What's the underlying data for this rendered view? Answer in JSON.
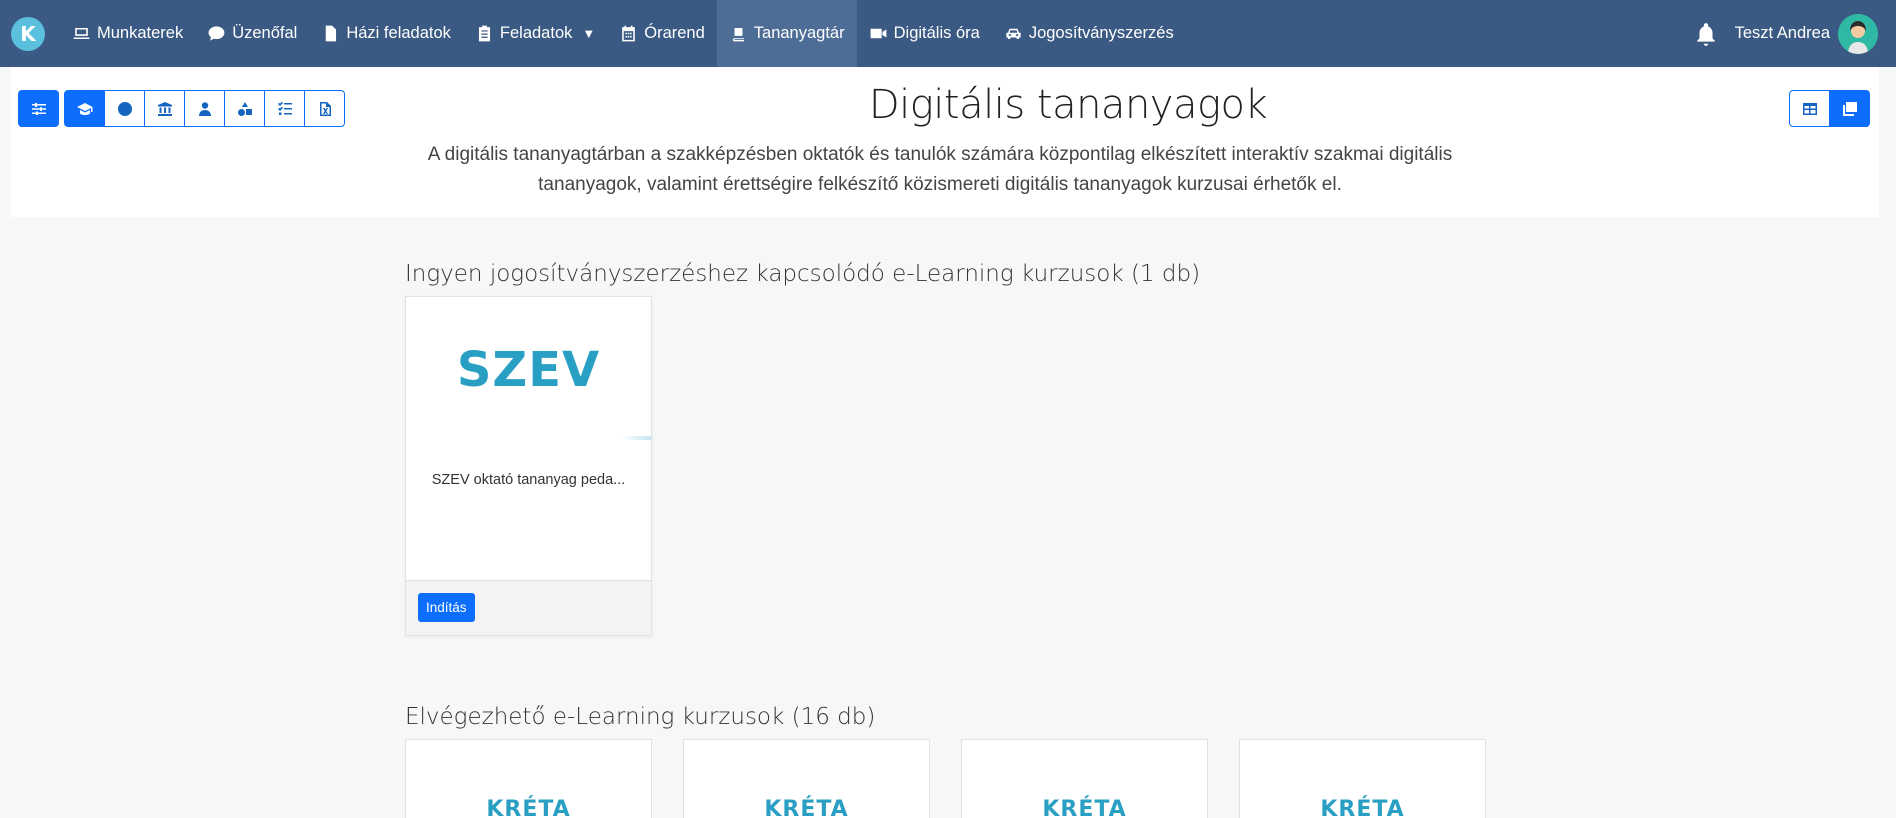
{
  "nav": {
    "logo_letter": "K",
    "items": [
      {
        "label": "Munkaterek",
        "icon": "laptop-icon"
      },
      {
        "label": "Üzenőfal",
        "icon": "chat-icon"
      },
      {
        "label": "Házi feladatok",
        "icon": "document-icon"
      },
      {
        "label": "Feladatok",
        "icon": "clipboard-icon",
        "caret": "▼"
      },
      {
        "label": "Órarend",
        "icon": "calendar-icon"
      },
      {
        "label": "Tananyagtár",
        "icon": "book-icon",
        "active": true
      },
      {
        "label": "Digitális óra",
        "icon": "video-icon"
      },
      {
        "label": "Jogosítványszerzés",
        "icon": "car-icon"
      }
    ],
    "user_name": "Teszt Andrea"
  },
  "page": {
    "title": "Digitális tananyagok",
    "description": "A digitális tananyagtárban a szakképzésben oktatók és tanulók számára központilag elkészített interaktív szakmai digitális tananyagok, valamint érettségire felkészítő közismereti digitális tananyagok kurzusai érhetők el."
  },
  "sections": [
    {
      "title": "Ingyen jogosítványszerzéshez kapcsolódó e-Learning kurzusok (1 db)",
      "cards": [
        {
          "logo": "SZEV",
          "title": "SZEV oktató tananyag peda...",
          "button": "Indítás"
        }
      ]
    },
    {
      "title": "Elvégezhető e-Learning kurzusok (16 db)",
      "cards": [
        {
          "logo": "KRÉTA"
        },
        {
          "logo": "KRÉTA"
        },
        {
          "logo": "KRÉTA"
        },
        {
          "logo": "KRÉTA"
        }
      ]
    }
  ],
  "colors": {
    "nav_bg": "#3b5a83",
    "nav_active": "#4d6d97",
    "primary": "#0d6efd",
    "logo_blue": "#2a9fc4"
  }
}
